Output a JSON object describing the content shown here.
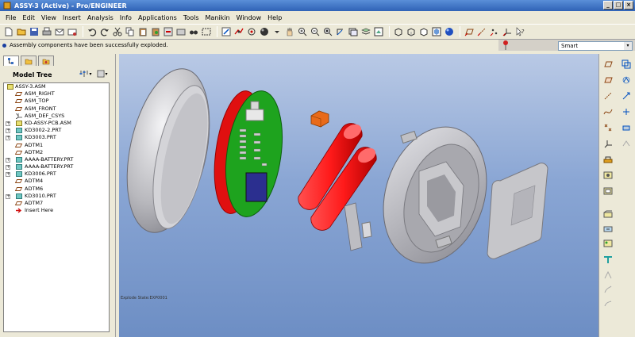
{
  "window": {
    "title": "ASSY-3 (Active) - Pro/ENGINEER",
    "min": "_",
    "max": "□",
    "close": "×"
  },
  "menu": [
    "File",
    "Edit",
    "View",
    "Insert",
    "Analysis",
    "Info",
    "Applications",
    "Tools",
    "Manikin",
    "Window",
    "Help"
  ],
  "message": "Assembly components have been successfully exploded.",
  "filter": {
    "selected": "Smart"
  },
  "model_tree": {
    "title": "Model Tree",
    "items": [
      {
        "label": "ASSY-3.ASM",
        "type": "root",
        "expander": ""
      },
      {
        "label": "ASM_RIGHT",
        "type": "plane",
        "expander": ""
      },
      {
        "label": "ASM_TOP",
        "type": "plane",
        "expander": ""
      },
      {
        "label": "ASM_FRONT",
        "type": "plane",
        "expander": ""
      },
      {
        "label": "ASM_DEF_CSYS",
        "type": "csys",
        "expander": ""
      },
      {
        "label": "KD-ASSY-PCB.ASM",
        "type": "asm",
        "expander": "+"
      },
      {
        "label": "KD3002-2.PRT",
        "type": "part",
        "expander": "+"
      },
      {
        "label": "KD3003.PRT",
        "type": "part",
        "expander": "+"
      },
      {
        "label": "ADTM1",
        "type": "plane",
        "expander": ""
      },
      {
        "label": "ADTM2",
        "type": "plane",
        "expander": ""
      },
      {
        "label": "AAAA-BATTERY.PRT",
        "type": "part",
        "expander": "+"
      },
      {
        "label": "AAAA-BATTERY.PRT",
        "type": "part",
        "expander": "+"
      },
      {
        "label": "KD3006.PRT",
        "type": "part",
        "expander": "+"
      },
      {
        "label": "ADTM4",
        "type": "plane",
        "expander": ""
      },
      {
        "label": "ADTM6",
        "type": "plane",
        "expander": ""
      },
      {
        "label": "KD3010.PRT",
        "type": "part",
        "expander": "+"
      },
      {
        "label": "ADTM7",
        "type": "plane",
        "expander": ""
      },
      {
        "label": "Insert Here",
        "type": "insert",
        "expander": ""
      }
    ]
  },
  "viewport": {
    "status_note": "Explode State:EXP0001"
  },
  "colors": {
    "battery": "#ff1a1a",
    "pcb": "#1ea31e",
    "shell": "#c8c8cc",
    "chip": "#2b2f8f",
    "connector": "#e86a1a"
  }
}
